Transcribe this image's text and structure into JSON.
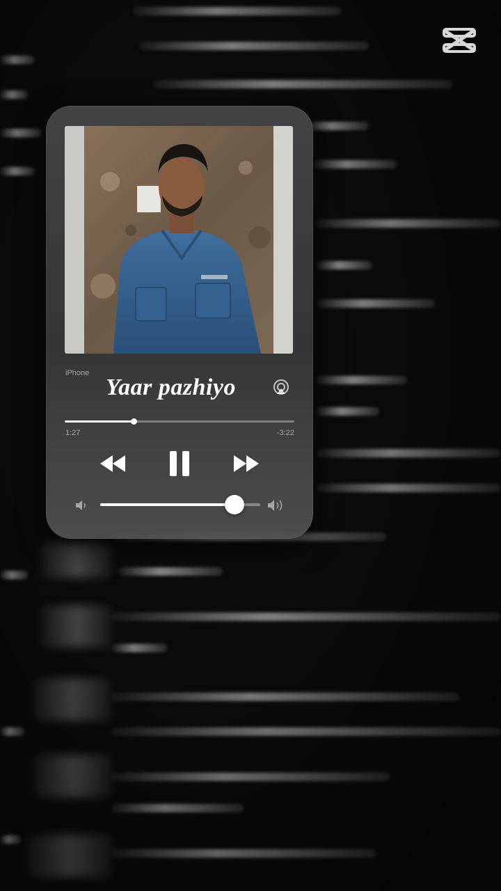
{
  "player": {
    "device_label": "iPhone",
    "song_title": "Yaar pazhiyo",
    "time_elapsed": "1:27",
    "time_remaining": "-3:22",
    "progress_fraction": 0.3,
    "volume_fraction": 0.84,
    "icons": {
      "rewind": "rewind-icon",
      "pause": "pause-icon",
      "forward": "fast-forward-icon",
      "airplay": "airplay-icon",
      "volume_low": "volume-low-icon",
      "volume_high": "volume-high-icon"
    }
  },
  "branding": {
    "logo": "capcut-logo-icon"
  },
  "colors": {
    "text": "#ffffff",
    "card": "#3a3a3c",
    "background": "#0b0b0b"
  }
}
